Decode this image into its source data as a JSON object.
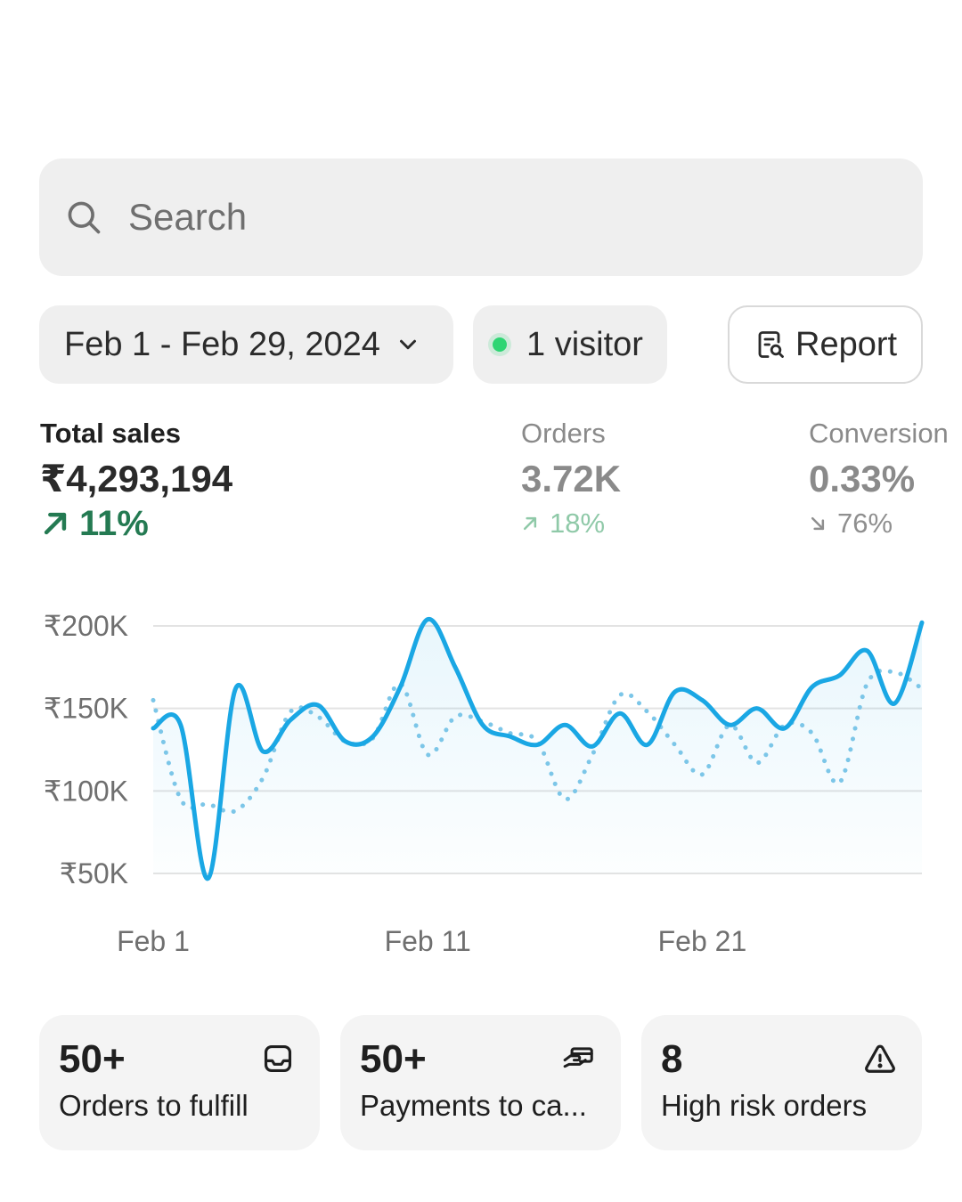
{
  "search": {
    "placeholder": "Search",
    "icon": "search-icon"
  },
  "filters": {
    "date_range": "Feb 1 - Feb 29, 2024",
    "visitors": "1 visitor",
    "visitor_dot_color": "#2ed573",
    "report_label": "Report"
  },
  "metrics": {
    "total_sales": {
      "label": "Total sales",
      "value": "₹4,293,194",
      "delta": "11%",
      "direction": "up",
      "color": "#247a52"
    },
    "orders": {
      "label": "Orders",
      "value": "3.72K",
      "delta": "18%",
      "direction": "up"
    },
    "conversion": {
      "label": "Conversion",
      "value": "0.33%",
      "delta": "76%",
      "direction": "down"
    }
  },
  "chart_data": {
    "type": "line",
    "yticks": [
      "₹200K",
      "₹150K",
      "₹100K",
      "₹50K"
    ],
    "ylim": [
      50000,
      200000
    ],
    "xticks": [
      {
        "day": 1,
        "label": "Feb 1"
      },
      {
        "day": 11,
        "label": "Feb 11"
      },
      {
        "day": 21,
        "label": "Feb 21"
      }
    ],
    "x": [
      1,
      2,
      3,
      4,
      5,
      6,
      7,
      8,
      9,
      10,
      11,
      12,
      13,
      14,
      15,
      16,
      17,
      18,
      19,
      20,
      21,
      22,
      23,
      24,
      25,
      26,
      27,
      28,
      29
    ],
    "series": [
      {
        "style": "solid",
        "color": "#1aa7e4",
        "values": [
          138000,
          140000,
          47000,
          162000,
          124000,
          143000,
          152000,
          130000,
          133000,
          163000,
          204000,
          175000,
          140000,
          133000,
          128000,
          140000,
          127000,
          147000,
          128000,
          160000,
          155000,
          140000,
          150000,
          138000,
          163000,
          170000,
          185000,
          153000,
          202000
        ]
      },
      {
        "style": "dotted",
        "color": "#7cc6e8",
        "values": [
          155000,
          95000,
          92000,
          88000,
          108000,
          148000,
          145000,
          130000,
          132000,
          165000,
          122000,
          145000,
          142000,
          135000,
          130000,
          95000,
          122000,
          158000,
          148000,
          128000,
          110000,
          140000,
          117000,
          140000,
          135000,
          105000,
          165000,
          172000,
          162000
        ]
      }
    ]
  },
  "cards": [
    {
      "count": "50+",
      "label": "Orders to fulfill",
      "icon": "inbox-icon"
    },
    {
      "count": "50+",
      "label": "Payments to ca...",
      "icon": "payment-hand-icon"
    },
    {
      "count": "8",
      "label": "High risk orders",
      "icon": "warning-icon"
    }
  ]
}
